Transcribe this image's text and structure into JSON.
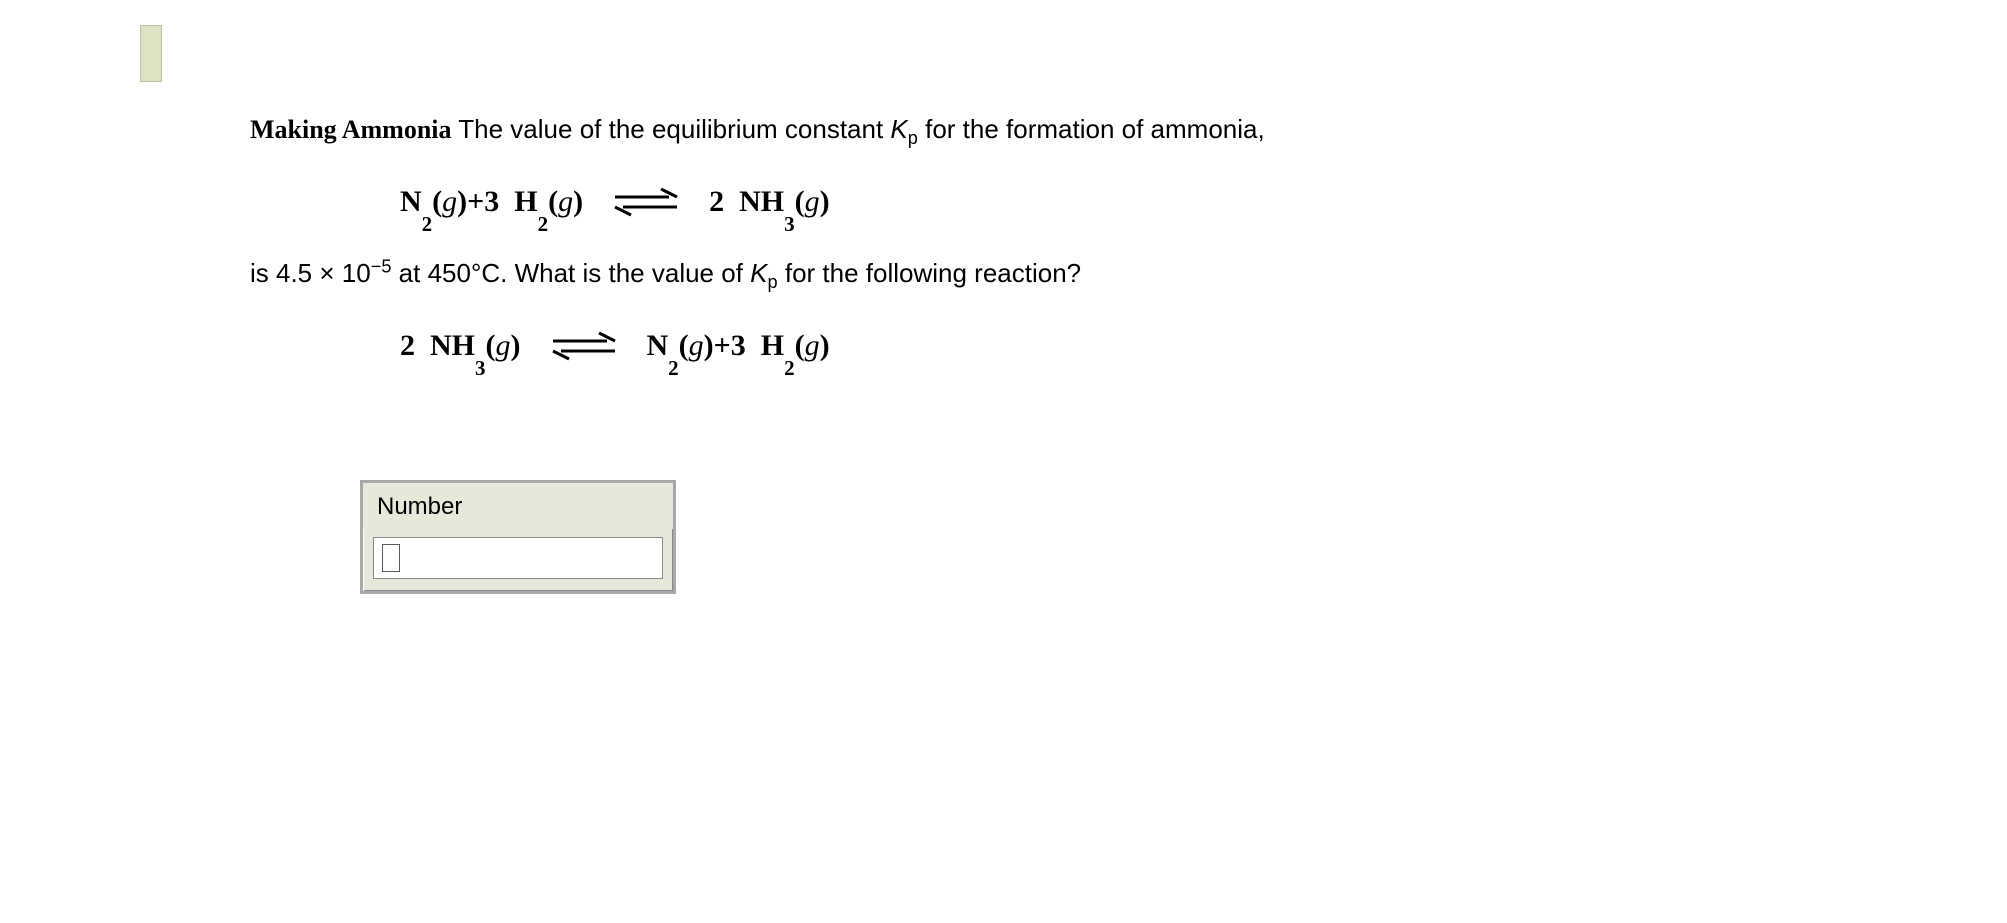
{
  "problem": {
    "title": "Making Ammonia",
    "intro_text_1": "  The value of the equilibrium constant ",
    "kp_symbol": "K",
    "kp_sub": "p",
    "intro_text_2": " for the formation of ammonia,",
    "value_prefix": "is 4.5 × 10",
    "value_exp": "−5",
    "value_suffix": " at 450°C. What is the value of ",
    "question_tail": " for the following reaction?"
  },
  "equation1": {
    "left1_formula": "N",
    "left1_sub": "2",
    "left1_phase": "g",
    "plus": " + ",
    "coeff_3": "3",
    "left2_formula": "H",
    "left2_sub": "2",
    "left2_phase": "g",
    "right_coeff": "2",
    "right_formula": "NH",
    "right_sub": "3",
    "right_phase": "g"
  },
  "equation2": {
    "left_coeff": "2",
    "left_formula": "NH",
    "left_sub": "3",
    "left_phase": "g",
    "right1_formula": "N",
    "right1_sub": "2",
    "right1_phase": "g",
    "plus": " + ",
    "coeff_3": "3",
    "right2_formula": "H",
    "right2_sub": "2",
    "right2_phase": "g"
  },
  "answer_box": {
    "label": "Number",
    "value": ""
  }
}
